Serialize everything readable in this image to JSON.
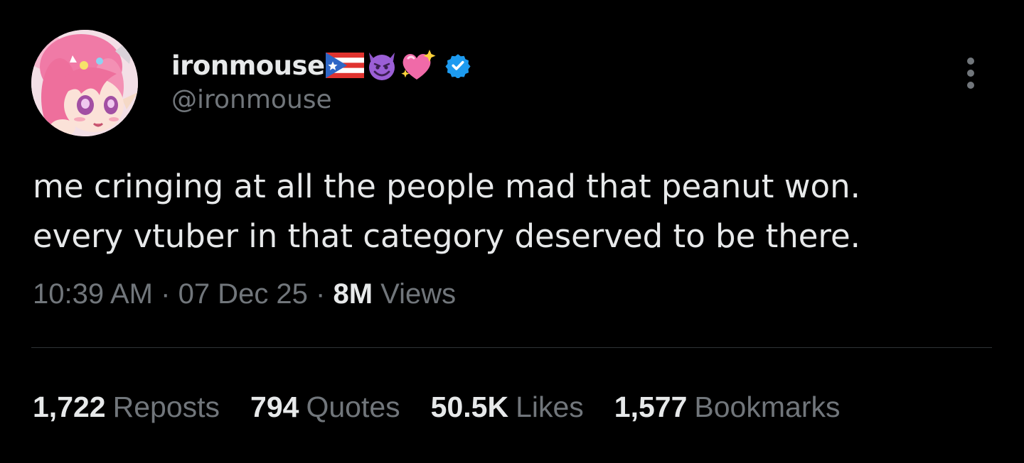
{
  "author": {
    "display_name": "ironmouse",
    "handle": "@ironmouse",
    "name_emojis": [
      "puerto-rico-flag",
      "smiling-devil-emoji",
      "sparkling-heart-emoji"
    ],
    "verified": true,
    "avatar_icon": "anime-avatar"
  },
  "tweet": {
    "text_lines": [
      "me cringing at all the people mad that peanut won.",
      "every vtuber in that category deserved to be there."
    ],
    "time": "10:39 AM",
    "separator": "·",
    "date": "07 Dec 25",
    "views_count": "8M",
    "views_label": "Views"
  },
  "stats": {
    "reposts_value": "1,722",
    "reposts_label": "Reposts",
    "quotes_value": "794",
    "quotes_label": "Quotes",
    "likes_value": "50.5K",
    "likes_label": "Likes",
    "bookmarks_value": "1,577",
    "bookmarks_label": "Bookmarks"
  },
  "icons": {
    "more": "more-vertical-icon",
    "verified": "verified-badge-icon"
  },
  "colors": {
    "background": "#000000",
    "primary_text": "#e7e9ea",
    "secondary_text": "#71767b",
    "divider": "#2f3336",
    "verified_blue": "#1d9bf0"
  }
}
